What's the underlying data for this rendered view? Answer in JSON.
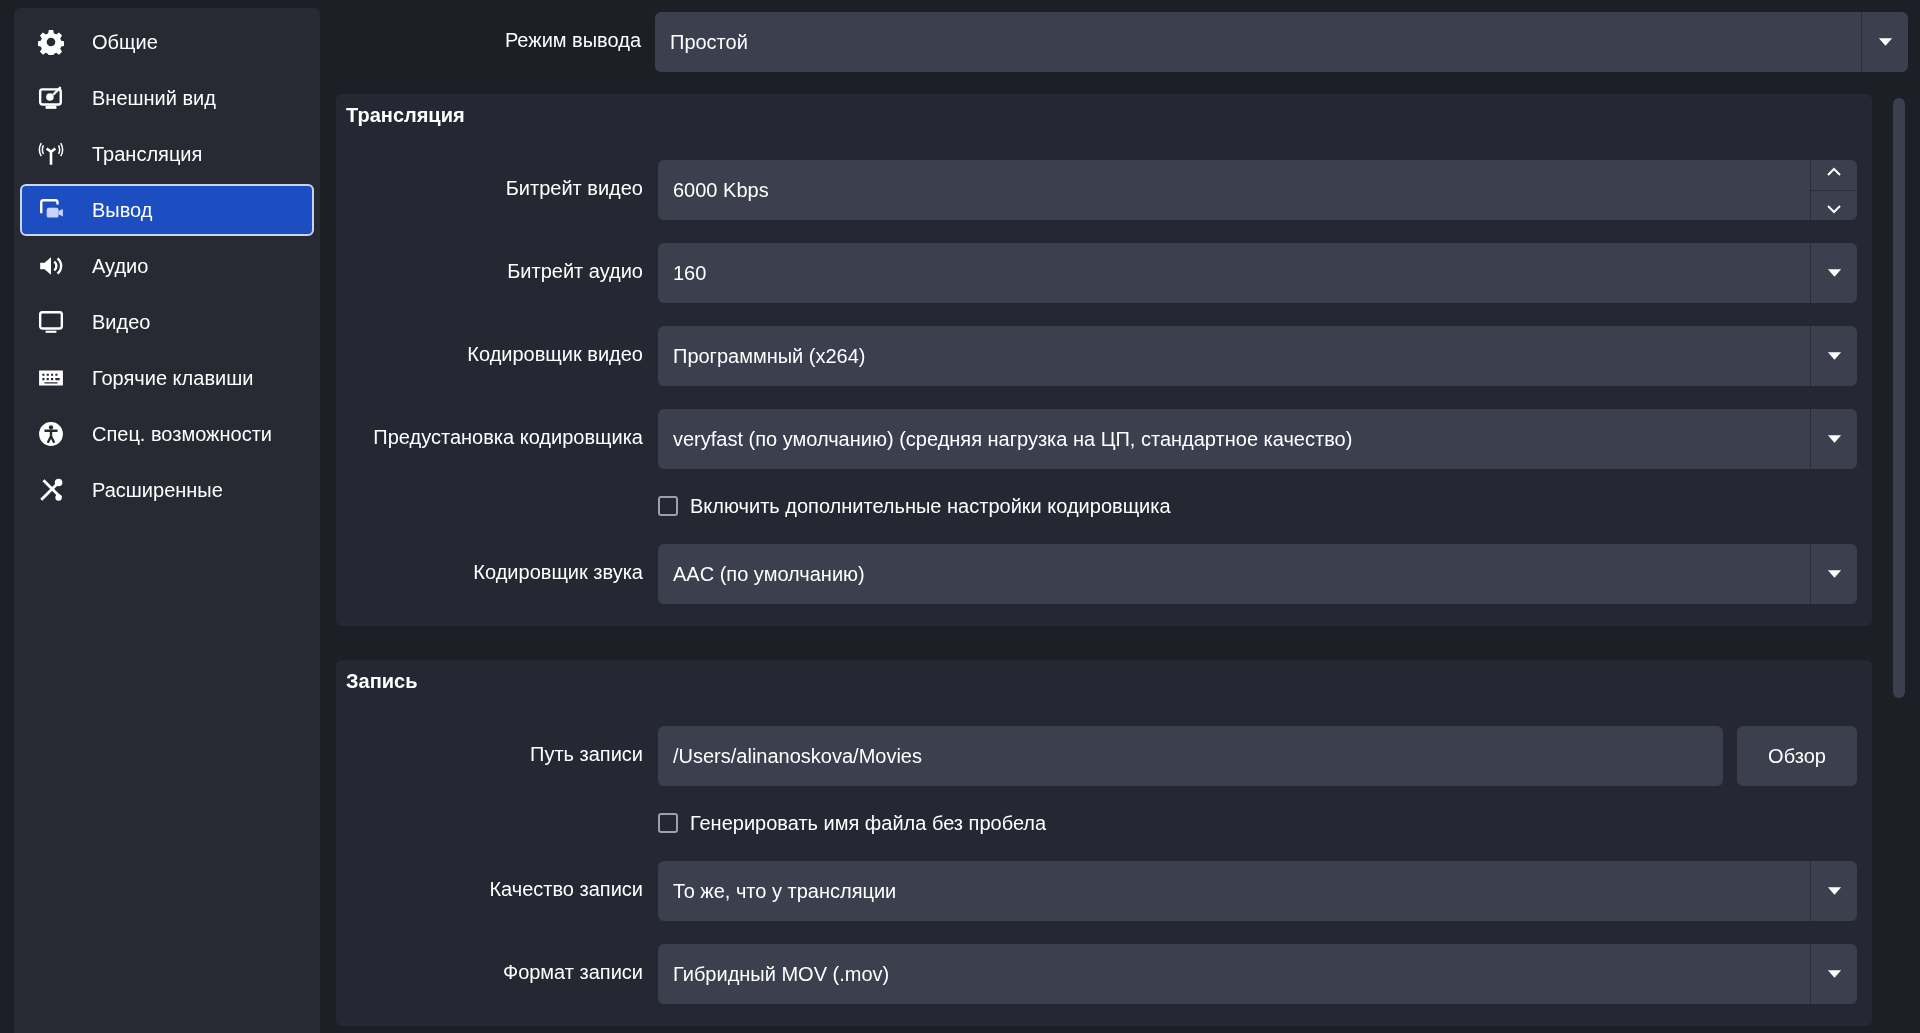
{
  "sidebar": {
    "items": [
      {
        "label": "Общие",
        "selected": false
      },
      {
        "label": "Внешний вид",
        "selected": false
      },
      {
        "label": "Трансляция",
        "selected": false
      },
      {
        "label": "Вывод",
        "selected": true
      },
      {
        "label": "Аудио",
        "selected": false
      },
      {
        "label": "Видео",
        "selected": false
      },
      {
        "label": "Горячие клавиши",
        "selected": false
      },
      {
        "label": "Спец. возможности",
        "selected": false
      },
      {
        "label": "Расширенные",
        "selected": false
      }
    ]
  },
  "output_mode": {
    "label": "Режим вывода",
    "value": "Простой"
  },
  "groups": [
    {
      "title": "Трансляция",
      "rows": [
        {
          "kind": "spin",
          "label": "Битрейт видео",
          "value": "6000 Kbps"
        },
        {
          "kind": "combo",
          "label": "Битрейт аудио",
          "value": "160"
        },
        {
          "kind": "combo",
          "label": "Кодировщик видео",
          "value": "Программный (x264)"
        },
        {
          "kind": "combo",
          "label": "Предустановка кодировщика",
          "value": "veryfast (по умолчанию) (средняя нагрузка на ЦП, стандартное качество)"
        },
        {
          "kind": "checkbox",
          "label": "Включить дополнительные настройки кодировщика",
          "checked": false
        },
        {
          "kind": "combo",
          "label": "Кодировщик звука",
          "value": "AAC (по умолчанию)"
        }
      ]
    },
    {
      "title": "Запись",
      "rows": [
        {
          "kind": "path",
          "label": "Путь записи",
          "value": "/Users/alinanoskova/Movies",
          "button": "Обзор"
        },
        {
          "kind": "checkbox",
          "label": "Генерировать имя файла без пробела",
          "checked": false
        },
        {
          "kind": "combo",
          "label": "Качество записи",
          "value": "То же, что у трансляции"
        },
        {
          "kind": "combo",
          "label": "Формат записи",
          "value": "Гибридный MOV (.mov)"
        }
      ]
    }
  ]
}
